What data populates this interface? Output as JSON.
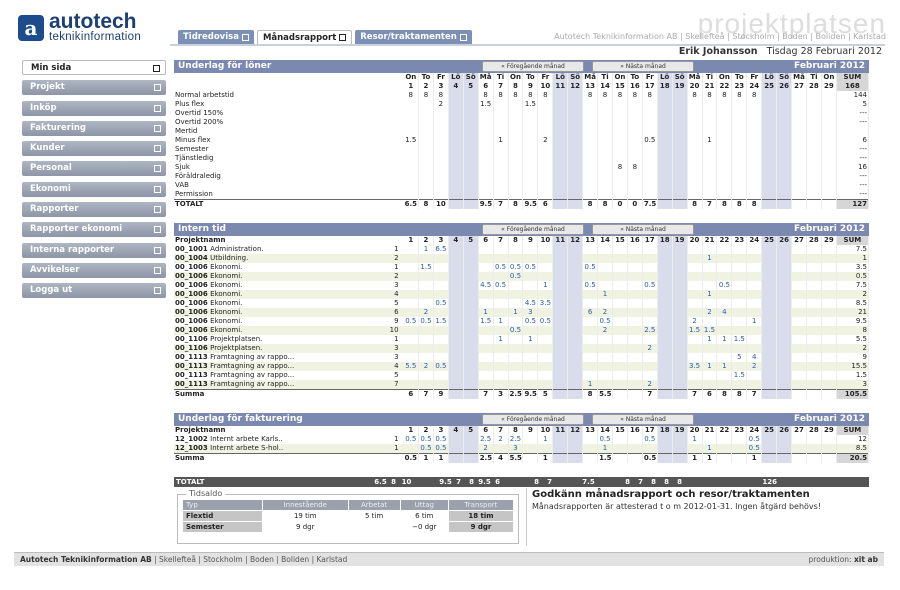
{
  "header": {
    "logo_name": "autotech",
    "logo_sub": "teknikinformation",
    "brand": "projektplatsen",
    "toplinks": "Autotech Teknikinformation AB | Skellefteå | Stockholm | Boden | Boliden | Karlstad",
    "user": "Erik Johansson",
    "date": "Tisdag 28 Februari 2012"
  },
  "tabs": [
    "Tidredovisa",
    "Månadsrapport",
    "Resor/traktamenten"
  ],
  "sidebar": [
    "Min sida",
    "Projekt",
    "Inköp",
    "Fakturering",
    "Kunder",
    "Personal",
    "Ekonomi",
    "Rapporter",
    "Rapporter ekonomi",
    "Interna rapporter",
    "Avvikelser",
    "Logga ut"
  ],
  "nav": {
    "prev": "« Föregående månad",
    "next": "» Nästa månad",
    "month": "Februari 2012"
  },
  "days": {
    "names": [
      "On",
      "To",
      "Fr",
      "Lö",
      "Sö",
      "Må",
      "Ti",
      "On",
      "To",
      "Fr",
      "Lö",
      "Sö",
      "Må",
      "Ti",
      "On",
      "To",
      "Fr",
      "Lö",
      "Sö",
      "Må",
      "Ti",
      "On",
      "To",
      "Fr",
      "Lö",
      "Sö",
      "Må",
      "Ti",
      "On"
    ],
    "nums": [
      "1",
      "2",
      "3",
      "4",
      "5",
      "6",
      "7",
      "8",
      "9",
      "10",
      "11",
      "12",
      "13",
      "14",
      "15",
      "16",
      "17",
      "18",
      "19",
      "20",
      "21",
      "22",
      "23",
      "24",
      "25",
      "26",
      "27",
      "28",
      "29"
    ],
    "weekend": [
      3,
      4,
      10,
      11,
      17,
      18,
      24,
      25
    ]
  },
  "loner": {
    "title": "Underlag för löner",
    "sum_label": "SUM",
    "sum_total": "168",
    "rows": [
      {
        "label": "Normal arbetstid",
        "v": [
          "8",
          "8",
          "8",
          "",
          "",
          "8",
          "8",
          "8",
          "8",
          "8",
          "",
          "",
          "8",
          "8",
          "8",
          "8",
          "8",
          "",
          "",
          "8",
          "8",
          "8",
          "8",
          "8",
          "",
          "",
          "",
          "",
          ""
        ],
        "sum": "144"
      },
      {
        "label": "Plus flex",
        "v": [
          "",
          "",
          "2",
          "",
          "",
          "1.5",
          "",
          "",
          "1.5",
          "",
          "",
          "",
          "",
          "",
          "",
          "",
          "",
          "",
          "",
          "",
          "",
          "",
          "",
          "",
          "",
          "",
          "",
          "",
          ""
        ],
        "sum": "5"
      },
      {
        "label": "Övertid 150%",
        "v": [],
        "sum": "---"
      },
      {
        "label": "Övertid 200%",
        "v": [],
        "sum": "---"
      },
      {
        "label": "Mertid",
        "v": [],
        "sum": ""
      },
      {
        "label": "Minus flex",
        "v": [
          "1.5",
          "",
          "",
          "",
          "",
          "",
          "1",
          "",
          "",
          "2",
          "",
          "",
          "",
          "",
          "",
          "",
          "0.5",
          "",
          "",
          "",
          "1",
          "",
          "",
          "",
          "",
          "",
          "",
          "",
          ""
        ],
        "sum": "6"
      },
      {
        "label": "Semester",
        "v": [],
        "sum": "---"
      },
      {
        "label": "Tjänstledig",
        "v": [],
        "sum": "---"
      },
      {
        "label": "Sjuk",
        "v": [
          "",
          "",
          "",
          "",
          "",
          "",
          "",
          "",
          "",
          "",
          "",
          "",
          "",
          "",
          "8",
          "8",
          "",
          "",
          "",
          "",
          "",
          "",
          "",
          "",
          "",
          "",
          "",
          "",
          ""
        ],
        "sum": "16"
      },
      {
        "label": "Föräldraledig",
        "v": [],
        "sum": "---"
      },
      {
        "label": "VAB",
        "v": [],
        "sum": "---"
      },
      {
        "label": "Permission",
        "v": [],
        "sum": "---"
      }
    ],
    "total": {
      "label": "TOTALT",
      "v": [
        "6.5",
        "8",
        "10",
        "",
        "",
        "9.5",
        "7",
        "8",
        "9.5",
        "6",
        "",
        "",
        "8",
        "8",
        "0",
        "0",
        "7.5",
        "",
        "",
        "8",
        "7",
        "8",
        "8",
        "8",
        "",
        "",
        "",
        "",
        ""
      ],
      "sum": "127"
    }
  },
  "intern": {
    "title": "Intern tid",
    "col_label": "Projektnamn",
    "sum_label": "SUM",
    "rows": [
      {
        "code": "00_1001",
        "name": "Administration.",
        "n": "1",
        "v": [
          "",
          "1",
          "6.5",
          "",
          "",
          "",
          "",
          "",
          "",
          "",
          "",
          "",
          "",
          "",
          "",
          "",
          "",
          "",
          "",
          "",
          "",
          "",
          "",
          "",
          "",
          "",
          "",
          "",
          ""
        ],
        "sum": "7.5"
      },
      {
        "code": "00_1004",
        "name": "Utbildning.",
        "n": "2",
        "v": [
          "",
          "",
          "",
          "",
          "",
          "",
          "",
          "",
          "",
          "",
          "",
          "",
          "",
          "",
          "",
          "",
          "",
          "",
          "",
          "",
          "1",
          "",
          "",
          "",
          "",
          "",
          "",
          "",
          ""
        ],
        "sum": "1"
      },
      {
        "code": "00_1006",
        "name": "Ekonomi.",
        "n": "1",
        "v": [
          "",
          "1.5",
          "",
          "",
          "",
          "",
          "0.5",
          "0.5",
          "0.5",
          "",
          "",
          "",
          "0.5",
          "",
          "",
          "",
          "",
          "",
          "",
          "",
          "",
          "",
          "",
          "",
          "",
          "",
          "",
          "",
          ""
        ],
        "sum": "3.5"
      },
      {
        "code": "00_1006",
        "name": "Ekonomi.",
        "n": "2",
        "v": [
          "",
          "",
          "",
          "",
          "",
          "",
          "",
          "0.5",
          "",
          "",
          "",
          "",
          "",
          "",
          "",
          "",
          "",
          "",
          "",
          "",
          "",
          "",
          "",
          "",
          "",
          "",
          "",
          "",
          ""
        ],
        "sum": "0.5"
      },
      {
        "code": "00_1006",
        "name": "Ekonomi.",
        "n": "3",
        "v": [
          "",
          "",
          "",
          "",
          "",
          "4.5",
          "0.5",
          "",
          "",
          "1",
          "",
          "",
          "0.5",
          "",
          "",
          "",
          "0.5",
          "",
          "",
          "",
          "",
          "0.5",
          "",
          "",
          "",
          "",
          "",
          "",
          ""
        ],
        "sum": "7.5"
      },
      {
        "code": "00_1006",
        "name": "Ekonomi.",
        "n": "4",
        "v": [
          "",
          "",
          "",
          "",
          "",
          "",
          "",
          "",
          "",
          "",
          "",
          "",
          "",
          "1",
          "",
          "",
          "",
          "",
          "",
          "",
          "1",
          "",
          "",
          "",
          "",
          "",
          "",
          "",
          ""
        ],
        "sum": "2"
      },
      {
        "code": "00_1006",
        "name": "Ekonomi.",
        "n": "5",
        "v": [
          "",
          "",
          "0.5",
          "",
          "",
          "",
          "",
          "",
          "4.5",
          "3.5",
          "",
          "",
          "",
          "",
          "",
          "",
          "",
          "",
          "",
          "",
          "",
          "",
          "",
          "",
          "",
          "",
          "",
          "",
          ""
        ],
        "sum": "8.5"
      },
      {
        "code": "00_1006",
        "name": "Ekonomi.",
        "n": "6",
        "v": [
          "",
          "2",
          "",
          "",
          "",
          "1",
          "",
          "1",
          "3",
          "",
          "",
          "",
          "6",
          "2",
          "",
          "",
          "",
          "",
          "",
          "",
          "2",
          "4",
          "",
          "",
          "",
          "",
          "",
          "",
          ""
        ],
        "sum": "21"
      },
      {
        "code": "00_1006",
        "name": "Ekonomi.",
        "n": "9",
        "v": [
          "0.5",
          "0.5",
          "1.5",
          "",
          "",
          "1.5",
          "1",
          "",
          "0.5",
          "0.5",
          "",
          "",
          "",
          "0.5",
          "",
          "",
          "",
          "",
          "",
          "2",
          "",
          "",
          "",
          "1",
          "",
          "",
          "",
          "",
          ""
        ],
        "sum": "9.5"
      },
      {
        "code": "00_1006",
        "name": "Ekonomi.",
        "n": "10",
        "v": [
          "",
          "",
          "",
          "",
          "",
          "",
          "",
          "0.5",
          "",
          "",
          "",
          "",
          "",
          "2",
          "",
          "",
          "2.5",
          "",
          "",
          "1.5",
          "1.5",
          "",
          "",
          "",
          "",
          "",
          "",
          "",
          ""
        ],
        "sum": "8"
      },
      {
        "code": "00_1106",
        "name": "Projektplatsen.",
        "n": "1",
        "v": [
          "",
          "",
          "",
          "",
          "",
          "",
          "1",
          "",
          "1",
          "",
          "",
          "",
          "",
          "",
          "",
          "",
          "",
          "",
          "",
          "",
          "1",
          "1",
          "1.5",
          "",
          "",
          "",
          "",
          "",
          ""
        ],
        "sum": "5.5"
      },
      {
        "code": "00_1106",
        "name": "Projektplatsen.",
        "n": "3",
        "v": [
          "",
          "",
          "",
          "",
          "",
          "",
          "",
          "",
          "",
          "",
          "",
          "",
          "",
          "",
          "",
          "",
          "2",
          "",
          "",
          "",
          "",
          "",
          "",
          "",
          "",
          "",
          "",
          "",
          ""
        ],
        "sum": "2"
      },
      {
        "code": "00_1113",
        "name": "Framtagning av rappo...",
        "n": "3",
        "v": [
          "",
          "",
          "",
          "",
          "",
          "",
          "",
          "",
          "",
          "",
          "",
          "",
          "",
          "",
          "",
          "",
          "",
          "",
          "",
          "",
          "",
          "",
          "5",
          "4",
          "",
          "",
          "",
          "",
          ""
        ],
        "sum": "9"
      },
      {
        "code": "00_1113",
        "name": "Framtagning av rappo...",
        "n": "4",
        "v": [
          "5.5",
          "2",
          "0.5",
          "",
          "",
          "",
          "",
          "",
          "",
          "",
          "",
          "",
          "",
          "",
          "",
          "",
          "",
          "",
          "",
          "3.5",
          "1",
          "1",
          "",
          "2",
          "",
          "",
          "",
          "",
          ""
        ],
        "sum": "15.5"
      },
      {
        "code": "00_1113",
        "name": "Framtagning av rappo...",
        "n": "5",
        "v": [
          "",
          "",
          "",
          "",
          "",
          "",
          "",
          "",
          "",
          "",
          "",
          "",
          "",
          "",
          "",
          "",
          "",
          "",
          "",
          "",
          "",
          "",
          "1.5",
          "",
          "",
          "",
          "",
          "",
          ""
        ],
        "sum": "1.5"
      },
      {
        "code": "00_1113",
        "name": "Framtagning av rappo...",
        "n": "7",
        "v": [
          "",
          "",
          "",
          "",
          "",
          "",
          "",
          "",
          "",
          "",
          "",
          "",
          "1",
          "",
          "",
          "",
          "2",
          "",
          "",
          "",
          "",
          "",
          "",
          "",
          "",
          "",
          "",
          "",
          ""
        ],
        "sum": "3"
      }
    ],
    "total": {
      "label": "Summa",
      "v": [
        "6",
        "7",
        "9",
        "",
        "",
        "7",
        "3",
        "2.5",
        "9.5",
        "5",
        "",
        "",
        "8",
        "5.5",
        "",
        "",
        "7",
        "",
        "",
        "7",
        "6",
        "8",
        "8",
        "7",
        "",
        "",
        "",
        "",
        ""
      ],
      "sum": "105.5"
    }
  },
  "faktura": {
    "title": "Underlag för fakturering",
    "col_label": "Projektnamn",
    "sum_label": "SUM",
    "rows": [
      {
        "code": "12_1002",
        "name": "Internt arbete Karls..",
        "n": "1",
        "v": [
          "0.5",
          "0.5",
          "0.5",
          "",
          "",
          "2.5",
          "2",
          "2.5",
          "",
          "1",
          "",
          "",
          "",
          "0.5",
          "",
          "",
          "0.5",
          "",
          "",
          "1",
          "",
          "",
          "",
          "0.5",
          "",
          "",
          "",
          "",
          ""
        ],
        "sum": "12"
      },
      {
        "code": "12_1003",
        "name": "Internt arbete S-hol..",
        "n": "1",
        "v": [
          "",
          "0.5",
          "0.5",
          "",
          "",
          "2",
          "",
          "3",
          "",
          "",
          "",
          "",
          "",
          "1",
          "",
          "",
          "",
          "",
          "",
          "",
          "1",
          "",
          "",
          "0.5",
          "",
          "",
          "",
          "",
          ""
        ],
        "sum": "8.5"
      }
    ],
    "total": {
      "label": "Summa",
      "v": [
        "0.5",
        "1",
        "1",
        "",
        "",
        "2.5",
        "4",
        "5.5",
        "",
        "1",
        "",
        "",
        "",
        "1.5",
        "",
        "",
        "0.5",
        "",
        "",
        "1",
        "1",
        "",
        "",
        "1",
        "",
        "",
        "",
        "",
        ""
      ],
      "sum": "20.5"
    }
  },
  "totalbar": {
    "label": "TOTALT",
    "v": [
      "6.5",
      "8",
      "10",
      "",
      "",
      "9.5",
      "7",
      "8",
      "9.5",
      "6",
      "",
      "",
      "8",
      "7",
      "",
      "",
      "7.5",
      "",
      "",
      "8",
      "7",
      "8",
      "8",
      "8",
      "",
      "",
      "",
      "",
      ""
    ],
    "sum": "126"
  },
  "tidsaldo": {
    "legend": "Tidsaldo",
    "headers": [
      "Typ",
      "Innestående",
      "Arbetat",
      "Uttag",
      "Transport"
    ],
    "rows": [
      [
        "Flextid",
        "19 tim",
        "5 tim",
        "6 tim",
        "18 tim"
      ],
      [
        "Semester",
        "9 dgr",
        "",
        "−0 dgr",
        "9 dgr"
      ]
    ]
  },
  "approve": {
    "title": "Godkänn månadsrapport och resor/traktamenten",
    "text": "Månadsrapporten är attesterad t o m 2012-01-31. Ingen åtgärd behövs!"
  },
  "footer": {
    "company": "Autotech Teknikinformation AB",
    "places": " | Skellefteå | Stockholm | Boden | Boliden | Karlstad",
    "credit": "produktion: ",
    "credit_bold": "xit ab"
  }
}
